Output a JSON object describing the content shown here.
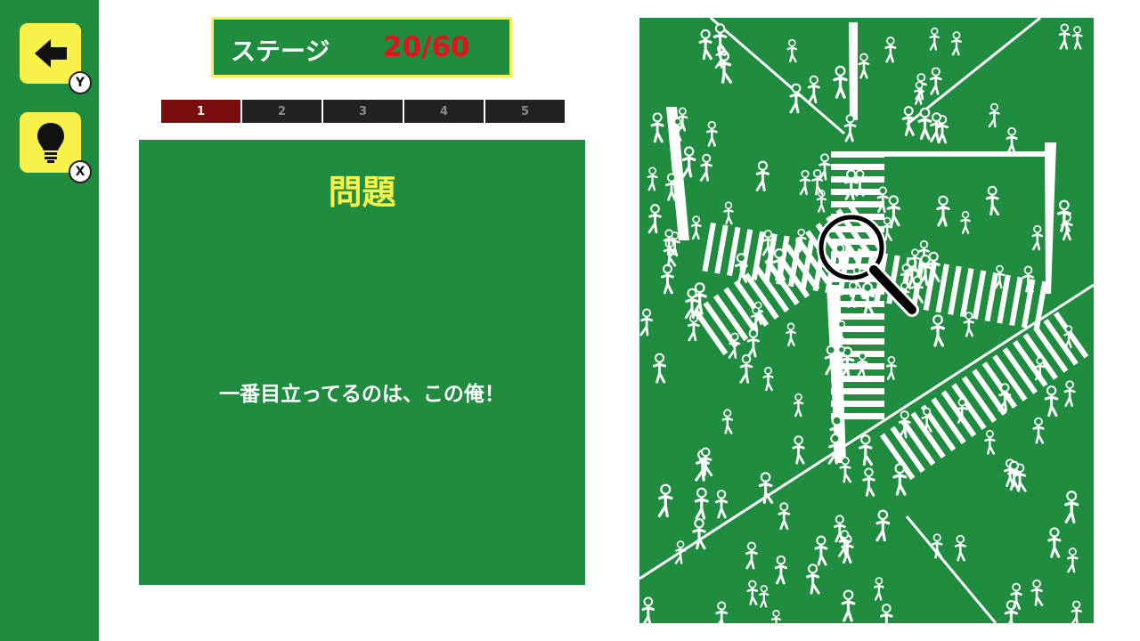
{
  "buttons": {
    "back": {
      "icon": "arrow-left-icon",
      "key": "Y"
    },
    "hint": {
      "icon": "lightbulb-icon",
      "key": "X"
    }
  },
  "stage": {
    "label": "ステージ",
    "count": "20/60"
  },
  "progress": {
    "steps": [
      "1",
      "2",
      "3",
      "4",
      "5"
    ],
    "current": 1
  },
  "question": {
    "title": "問題",
    "text": "一番目立ってるのは、この俺！"
  },
  "colors": {
    "accent_yellow": "#f7f24a",
    "field_green": "#1f8c3f",
    "stage_count_red": "#e8121a",
    "active_step": "#7a0d0d"
  },
  "puzzle": {
    "cursor_icon": "magnifier-icon"
  }
}
